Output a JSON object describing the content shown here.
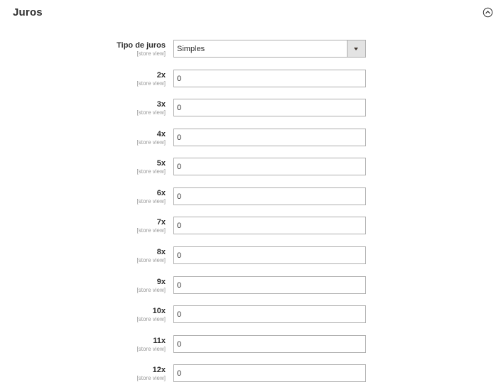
{
  "section": {
    "title": "Juros",
    "toggle_icon": "collapse-up-circle-icon"
  },
  "tipo_de_juros": {
    "label": "Tipo de juros",
    "scope": "[store view]",
    "value": "Simples"
  },
  "installments": [
    {
      "label": "2x",
      "scope": "[store view]",
      "value": "0"
    },
    {
      "label": "3x",
      "scope": "[store view]",
      "value": "0"
    },
    {
      "label": "4x",
      "scope": "[store view]",
      "value": "0"
    },
    {
      "label": "5x",
      "scope": "[store view]",
      "value": "0"
    },
    {
      "label": "6x",
      "scope": "[store view]",
      "value": "0"
    },
    {
      "label": "7x",
      "scope": "[store view]",
      "value": "0"
    },
    {
      "label": "8x",
      "scope": "[store view]",
      "value": "0"
    },
    {
      "label": "9x",
      "scope": "[store view]",
      "value": "0"
    },
    {
      "label": "10x",
      "scope": "[store view]",
      "value": "0"
    },
    {
      "label": "11x",
      "scope": "[store view]",
      "value": "0"
    },
    {
      "label": "12x",
      "scope": "[store view]",
      "value": "0"
    }
  ]
}
